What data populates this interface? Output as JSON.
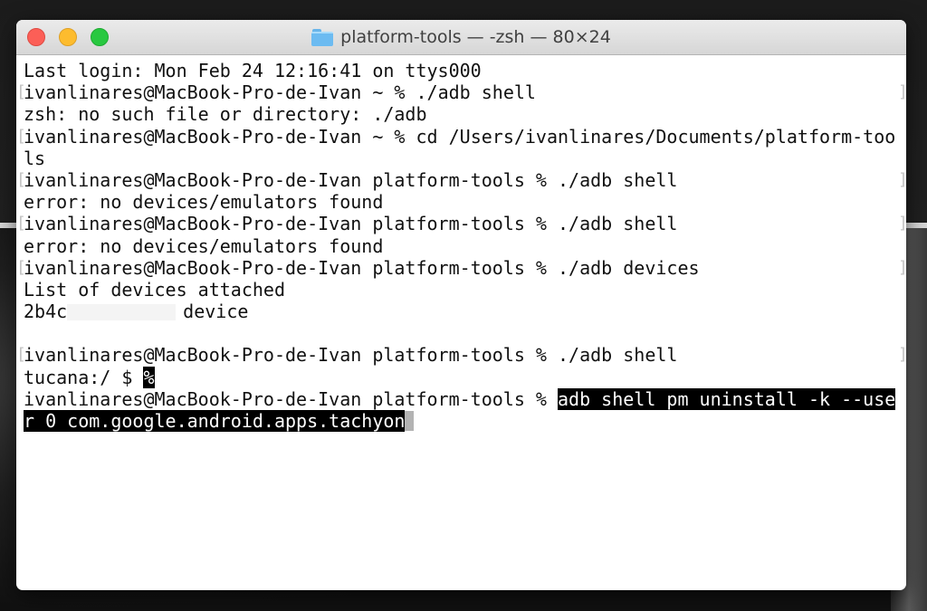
{
  "window": {
    "title": "platform-tools — -zsh — 80×24"
  },
  "terminal": {
    "last_login": "Last login: Mon Feb 24 12:16:41 on ttys000",
    "prompt_home": "ivanlinares@MacBook-Pro-de-Ivan ~ % ",
    "prompt_pt": "ivanlinares@MacBook-Pro-de-Ivan platform-tools % ",
    "cmd1": "./adb shell",
    "out1": "zsh: no such file or directory: ./adb",
    "cmd2_a": "cd /Users/ivanlinares/Documents/platform-too",
    "cmd2_b": "ls",
    "cmd3": "./adb shell",
    "out3": "error: no devices/emulators found",
    "cmd4": "./adb shell",
    "out4": "error: no devices/emulators found",
    "cmd5": "./adb devices",
    "out5": "List of devices attached",
    "device_id": "2b4c",
    "device_state": "device",
    "cmd6": "./adb shell",
    "device_prompt": "tucana:/ $ ",
    "device_cursor_char": "%",
    "cmd7_a": "adb shell pm uninstall -k --use",
    "cmd7_b": "r 0 com.google.android.apps.tachyon",
    "mark_left": "[",
    "mark_right": "]"
  },
  "colors": {
    "close": "#fc5f57",
    "minimize": "#fdbc2e",
    "maximize": "#28c840",
    "selection": "#000000"
  },
  "icons": {
    "title_icon": "folder-icon"
  }
}
